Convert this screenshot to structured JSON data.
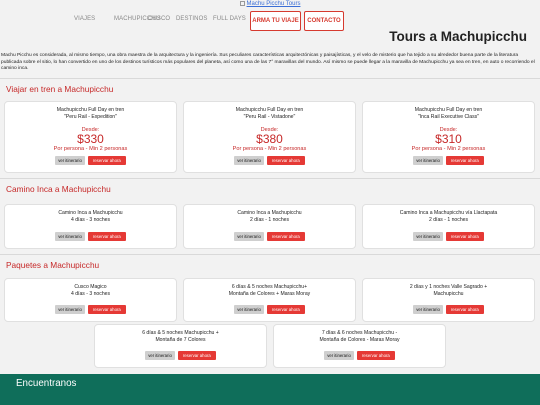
{
  "header": {
    "logo_alt": "Machu Picchu Tours"
  },
  "nav": {
    "items": [
      "VIAJES",
      "MACHUPICCHU",
      "CUSCO",
      "DESTINOS",
      "FULL DAYS"
    ],
    "cta": "ARMA TU VIAJE",
    "contact": "CONTACTO"
  },
  "page": {
    "title": "Tours a Machupicchu",
    "intro": "Machu Picchu es considerada, al mismo tiempo, una obra maestra de la arquitectura y la ingeniería. Sus peculiares características arquitectónicas y paisajísticas, y el velo de misterio que ha tejido a su alrededor buena parte de la literatura publicada sobre el sitio, lo han convertido en uno de los destinos turísticos más populares del planeta, así como una de las 7° maravillas del mundo. Así mismo se puede llegar a la maravilla de Machupicchu ya sea en tren, en auto o recorriendo el camino inca."
  },
  "sections": [
    {
      "title": "Viajar en tren a Machupicchu",
      "cards": [
        {
          "line1": "Machupicchu Full Day en tren",
          "line2": "\"Peru Rail - Expedition\"",
          "desde": "Desde:",
          "price": "$330",
          "persona": "Por persona - Min 2 personas"
        },
        {
          "line1": "Machupicchu Full Day en tren",
          "line2": "\"Peru Rail - Vistadone\"",
          "desde": "Desde:",
          "price": "$380",
          "persona": "Por persona - Min 2 personas"
        },
        {
          "line1": "Machupicchu Full Day en tren",
          "line2": "\"Inca Rail Executive Class\"",
          "desde": "Desde:",
          "price": "$310",
          "persona": "Por persona - Min 2 personas"
        }
      ]
    },
    {
      "title": "Camino Inca a Machupicchu",
      "cards": [
        {
          "line1": "Camino Inca a Machupicchu",
          "line2": "4 días - 3 noches"
        },
        {
          "line1": "Camino Inca a Machupicchu",
          "line2": "2 días - 1 noches"
        },
        {
          "line1": "Camino Inca a Machupicchu vía Llactapata",
          "line2": "2 días - 1 noches"
        }
      ]
    },
    {
      "title": "Paquetes a Machupicchu",
      "cards": [
        {
          "line1": "Cusco Magico",
          "line2": "4 días - 3 noches"
        },
        {
          "line1": "6 días & 5 noches Machupicchu+",
          "line2": "Montaña de Colores + Maras Moray"
        },
        {
          "line1": "2 días y 1 noches Valle Sagrado +",
          "line2": "Machupicchu"
        },
        {
          "line1": "6 días & 5 noches Machupicchu +",
          "line2": "Montaña de 7 Colores"
        },
        {
          "line1": "7 días & 6 noches Machupicchu -",
          "line2": "Montaña de Colores - Maras Moray"
        }
      ]
    }
  ],
  "buttons": {
    "itinerary": "ver itinerario",
    "book": "reservar ahora"
  },
  "footer": {
    "label": "Encuentranos"
  },
  "colors": {
    "accent": "#c62828",
    "footer": "#0f6e5a",
    "button_red": "#e53935"
  }
}
